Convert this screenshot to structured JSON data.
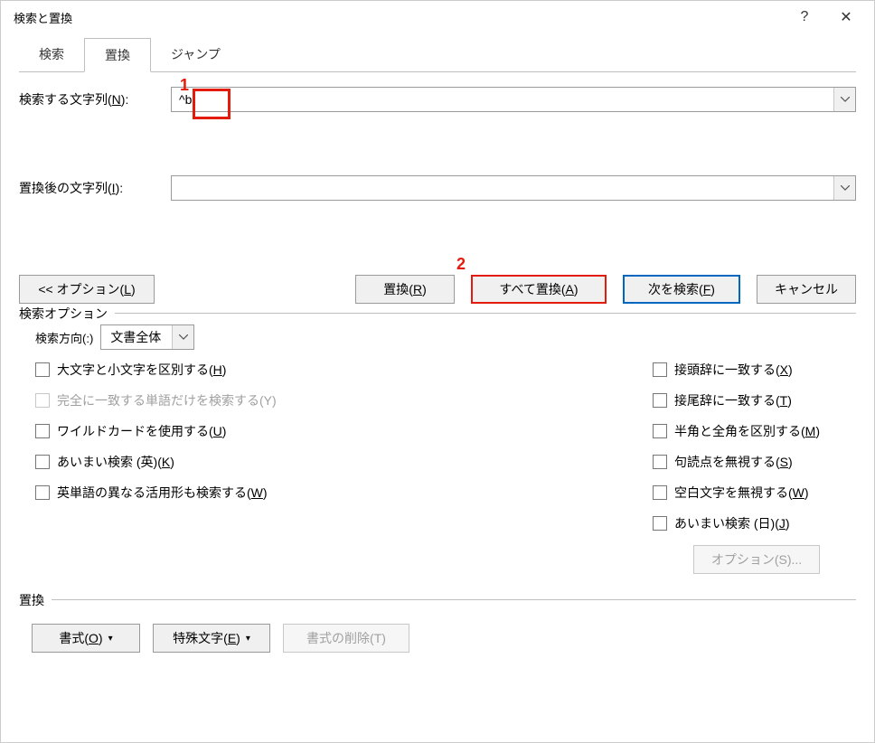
{
  "title": "検索と置換",
  "titlebar": {
    "help": "?",
    "close": "✕"
  },
  "tabs": {
    "search": "検索",
    "replace": "置換",
    "jump": "ジャンプ"
  },
  "fields": {
    "findLabelPre": "検索する文字列(",
    "findLabelU": "N",
    "findLabelPost": "):",
    "findValue": "^b",
    "replaceLabelPre": "置換後の文字列(",
    "replaceLabelU": "I",
    "replaceLabelPost": "):",
    "replaceValue": ""
  },
  "buttons": {
    "options": "<< オプション(",
    "optionsU": "L",
    "optionsPost": ")",
    "replace": "置換(",
    "replaceU": "R",
    "replacePost": ")",
    "replaceAll": "すべて置換(",
    "replaceAllU": "A",
    "replaceAllPost": ")",
    "findNext": "次を検索(",
    "findNextU": "F",
    "findNextPost": ")",
    "cancel": "キャンセル",
    "optionsS": "オプション(S)...",
    "format": "書式(",
    "formatU": "O",
    "formatPost": ")",
    "special": "特殊文字(",
    "specialU": "E",
    "specialPost": ")",
    "clearFmt": "書式の削除(T)"
  },
  "searchOptions": {
    "legend": "検索オプション",
    "dirLabelPre": "検索方向(",
    "dirLabelPost": ")",
    "dirValue": "文書全体",
    "matchCasePre": "大文字と小文字を区別する(",
    "matchCaseU": "H",
    "matchCasePost": ")",
    "wholeWord": "完全に一致する単語だけを検索する(Y)",
    "wildcardPre": "ワイルドカードを使用する(",
    "wildcardU": "U",
    "wildcardPost": ")",
    "fuzzyEnPre": "あいまい検索 (英)(",
    "fuzzyEnU": "K",
    "fuzzyEnPost": ")",
    "wordFormsPre": "英単語の異なる活用形も検索する(",
    "wordFormsU": "W",
    "wordFormsPost": ")",
    "prefixPre": "接頭辞に一致する(",
    "prefixU": "X",
    "prefixPost": ")",
    "suffixPre": "接尾辞に一致する(",
    "suffixU": "T",
    "suffixPost": ")",
    "widthPre": "半角と全角を区別する(",
    "widthU": "M",
    "widthPost": ")",
    "punctPre": "句読点を無視する(",
    "punctU": "S",
    "punctPost": ")",
    "whitespacePre": "空白文字を無視する(",
    "whitespaceU": "W",
    "whitespacePost": ")",
    "fuzzyJpPre": "あいまい検索 (日)(",
    "fuzzyJpU": "J",
    "fuzzyJpPost": ")"
  },
  "replaceSection": {
    "legend": "置換"
  },
  "annotations": {
    "num1": "1",
    "num2": "2"
  }
}
